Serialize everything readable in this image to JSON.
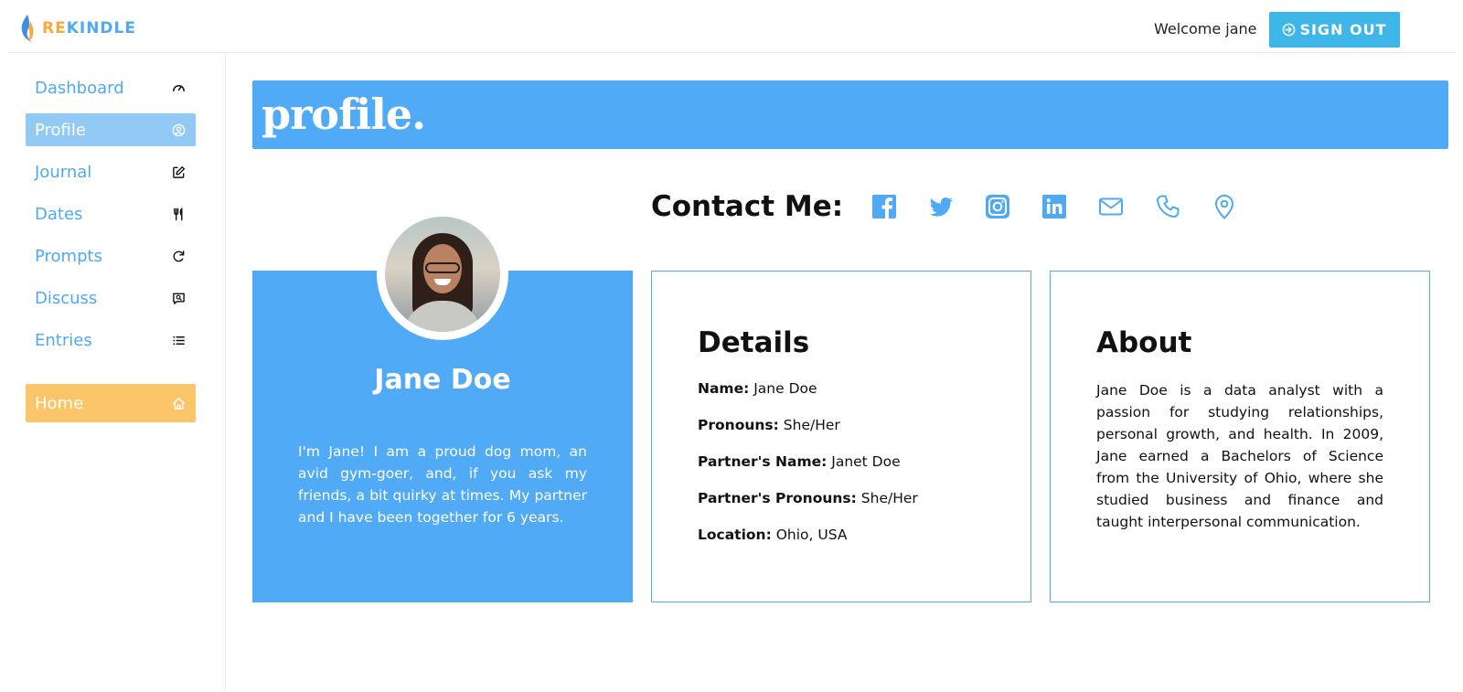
{
  "header": {
    "logo_text_accent": "RE",
    "logo_text_rest": "KINDLE",
    "welcome_text": "Welcome jane",
    "signout_label": "SIGN OUT"
  },
  "sidebar": {
    "items": [
      {
        "label": "Dashboard",
        "icon": "gauge-icon",
        "active": false
      },
      {
        "label": "Profile",
        "icon": "user-circle-icon",
        "active": true
      },
      {
        "label": "Journal",
        "icon": "edit-icon",
        "active": false
      },
      {
        "label": "Dates",
        "icon": "utensils-icon",
        "active": false
      },
      {
        "label": "Prompts",
        "icon": "refresh-icon",
        "active": false
      },
      {
        "label": "Discuss",
        "icon": "message-search-icon",
        "active": false
      },
      {
        "label": "Entries",
        "icon": "list-icon",
        "active": false
      }
    ],
    "home": {
      "label": "Home",
      "icon": "home-icon"
    }
  },
  "page": {
    "title": "profile."
  },
  "contact": {
    "title": "Contact Me:",
    "icons": [
      "facebook-icon",
      "twitter-icon",
      "instagram-icon",
      "linkedin-icon",
      "mail-icon",
      "phone-icon",
      "location-pin-icon"
    ]
  },
  "profile_card": {
    "name": "Jane Doe",
    "bio": "I'm Jane! I am a proud dog mom, an avid gym-goer, and, if you ask my friends, a bit quirky at times. My partner and I have been together for 6 years."
  },
  "details": {
    "title": "Details",
    "rows": [
      {
        "label": "Name:",
        "value": "Jane Doe"
      },
      {
        "label": "Pronouns:",
        "value": "She/Her"
      },
      {
        "label": "Partner's Name:",
        "value": "Janet Doe"
      },
      {
        "label": "Partner's Pronouns:",
        "value": "She/Her"
      },
      {
        "label": "Location:",
        "value": "Ohio, USA"
      }
    ]
  },
  "about": {
    "title": "About",
    "text": "Jane Doe is a data analyst with a passion for studying relationships, personal growth, and health. In 2009, Jane earned a Bachelors of Science from the University of Ohio, where she studied business and finance and taught interpersonal communication."
  },
  "colors": {
    "accent_blue": "#51aaf6",
    "active_nav": "#93caf5",
    "home_orange": "#fbc56a",
    "signout_blue": "#3fb6e8",
    "logo_orange": "#f9a93a"
  }
}
